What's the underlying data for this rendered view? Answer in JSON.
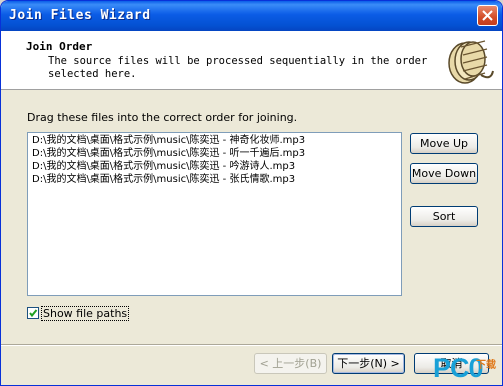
{
  "window": {
    "title": "Join Files Wizard"
  },
  "header": {
    "title": "Join Order",
    "description": "The source files will be processed sequentially in the order selected here."
  },
  "instruction": "Drag these files into the correct order for joining.",
  "files": [
    "D:\\我的文档\\桌面\\格式示例\\music\\陈奕迅 - 神奇化妆师.mp3",
    "D:\\我的文档\\桌面\\格式示例\\music\\陈奕迅 - 听一千遍后.mp3",
    "D:\\我的文档\\桌面\\格式示例\\music\\陈奕迅 - 吟游诗人.mp3",
    "D:\\我的文档\\桌面\\格式示例\\music\\陈奕迅 - 张氏情歌.mp3"
  ],
  "buttons": {
    "move_up": "Move Up",
    "move_down": "Move Down",
    "sort": "Sort",
    "back": "< 上一步(B)",
    "next": "下一步(N) >",
    "cancel": "取消"
  },
  "show_paths": {
    "label": "Show file paths",
    "checked": true
  },
  "watermark": {
    "text": "PC0",
    "subtext": "下载"
  },
  "colors": {
    "titlebar": "#0b5ce6",
    "accent_watermark": "#19a0d7"
  }
}
